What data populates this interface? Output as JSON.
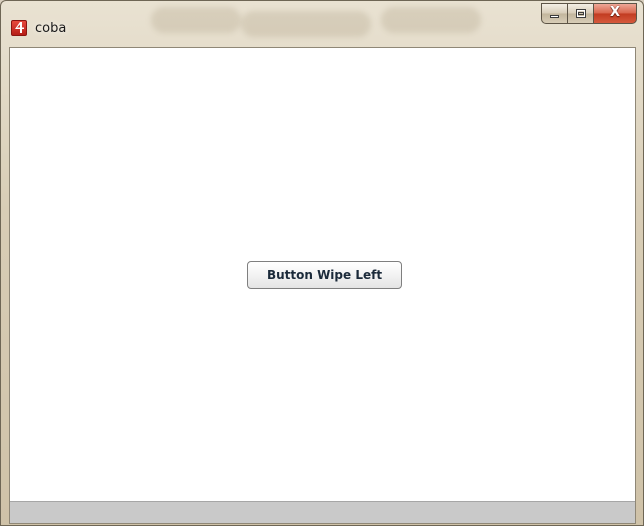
{
  "window": {
    "title": "coba",
    "app_icon": "app-logo-icon",
    "caption_buttons": {
      "minimize_icon": "minimize-icon",
      "maximize_icon": "maximize-icon",
      "close_label": "X",
      "close_color": "#c13b21"
    }
  },
  "main": {
    "button_label": "Button Wipe Left",
    "background": "#ffffff"
  },
  "status_bar": {
    "color": "#c9c9c9"
  }
}
